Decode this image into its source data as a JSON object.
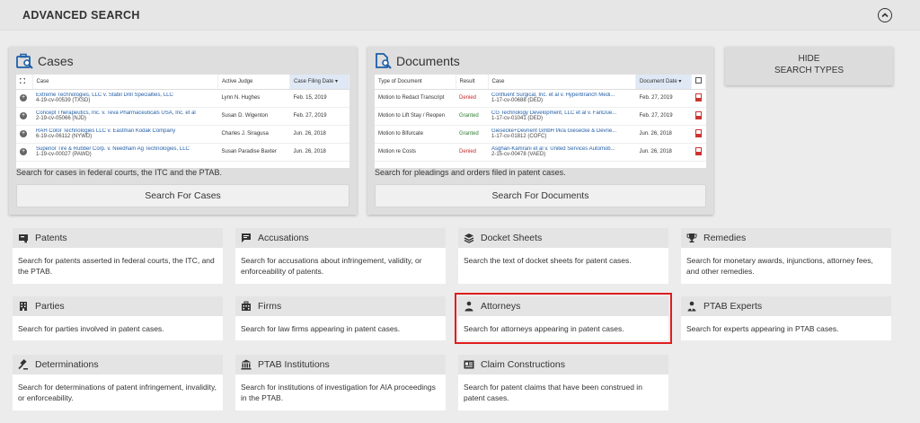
{
  "header": {
    "title": "ADVANCED SEARCH"
  },
  "cases": {
    "title": "Cases",
    "columns": [
      "Case",
      "Active Judge",
      "Case Filing Date"
    ],
    "rows": [
      {
        "case": "Extreme Technologies, LLC v. Stabil Drill Specialties, LLC",
        "number": "4-19-cv-00539 (TXSD)",
        "judge": "Lynn N. Hughes",
        "date": "Feb. 15, 2019"
      },
      {
        "case": "Concept Therapeutics, Inc. v. Teva Pharmaceuticals USA, Inc. et al",
        "number": "2-19-cv-05066 (NJD)",
        "judge": "Susan D. Wigenton",
        "date": "Feb. 27, 2019"
      },
      {
        "case": "RAH Color Technologies LLC v. Eastman Kodak Company",
        "number": "6-19-cv-06112 (NYWD)",
        "judge": "Charles J. Siragusa",
        "date": "Jun. 26, 2018"
      },
      {
        "case": "Superior Tire & Rubber Corp. v. Needham Ag Technologies, LLC",
        "number": "1-19-cv-00027 (PAWD)",
        "judge": "Susan Paradise Baxter",
        "date": "Jun. 26, 2018"
      }
    ],
    "description": "Search for cases in federal courts, the ITC and the PTAB.",
    "button": "Search For Cases"
  },
  "documents": {
    "title": "Documents",
    "columns": [
      "Type of Document",
      "Result",
      "Case",
      "Document Date"
    ],
    "rows": [
      {
        "type": "Motion to Redact Transcript",
        "result": "Denied",
        "case": "Confluent Surgical, Inc. et al v. HyperBranch Medi...",
        "number": "1-17-cv-00688 (DED)",
        "date": "Feb. 27, 2019"
      },
      {
        "type": "Motion to Lift Stay / Reopen",
        "result": "Granted",
        "case": "CG Technology Development, LLC et al v. FanDue...",
        "number": "1-17-cv-01041 (DED)",
        "date": "Feb. 27, 2019"
      },
      {
        "type": "Motion to Bifurcate",
        "result": "Granted",
        "case": "Giesecke+Devrient GmbH f/k/a Giesecke & Devrie...",
        "number": "1-17-cv-01812 (COFC)",
        "date": "Jun. 26, 2018"
      },
      {
        "type": "Motion re Costs",
        "result": "Denied",
        "case": "Asghari-Kamrani et al v. United Services Automob...",
        "number": "2-15-cv-00478 (VAED)",
        "date": "Jun. 26, 2018"
      }
    ],
    "description": "Search for pleadings and orders filed in patent cases.",
    "button": "Search For Documents"
  },
  "hide_button": {
    "line1": "HIDE",
    "line2": "SEARCH TYPES"
  },
  "search_types": [
    {
      "label": "Patents",
      "icon": "patent-icon",
      "desc": "Search for patents asserted in federal courts, the ITC, and the PTAB."
    },
    {
      "label": "Accusations",
      "icon": "accusation-icon",
      "desc": "Search for accusations about infringement, validity, or enforceability of patents."
    },
    {
      "label": "Docket Sheets",
      "icon": "layers-icon",
      "desc": "Search the text of docket sheets for patent cases."
    },
    {
      "label": "Remedies",
      "icon": "trophy-icon",
      "desc": "Search for monetary awards, injunctions, attorney fees, and other remedies."
    },
    {
      "label": "Parties",
      "icon": "building-icon",
      "desc": "Search for parties involved in patent cases."
    },
    {
      "label": "Firms",
      "icon": "firm-icon",
      "desc": "Search for law firms appearing in patent cases."
    },
    {
      "label": "Attorneys",
      "icon": "person-icon",
      "desc": "Search for attorneys appearing in patent cases."
    },
    {
      "label": "PTAB Experts",
      "icon": "expert-icon",
      "desc": "Search for experts appearing in PTAB cases."
    },
    {
      "label": "Determinations",
      "icon": "gavel-icon",
      "desc": "Search for determinations of patent infringement, invalidity, or enforceability."
    },
    {
      "label": "PTAB Institutions",
      "icon": "institution-icon",
      "desc": "Search for institutions of investigation for AIA proceedings in the PTAB."
    },
    {
      "label": "Claim Constructions",
      "icon": "claims-icon",
      "desc": "Search for patent claims that have been construed in patent cases."
    }
  ],
  "colors": {
    "highlight": "#e01e1e",
    "link": "#2460a7",
    "denied": "#c62828",
    "granted": "#2e7d32"
  }
}
